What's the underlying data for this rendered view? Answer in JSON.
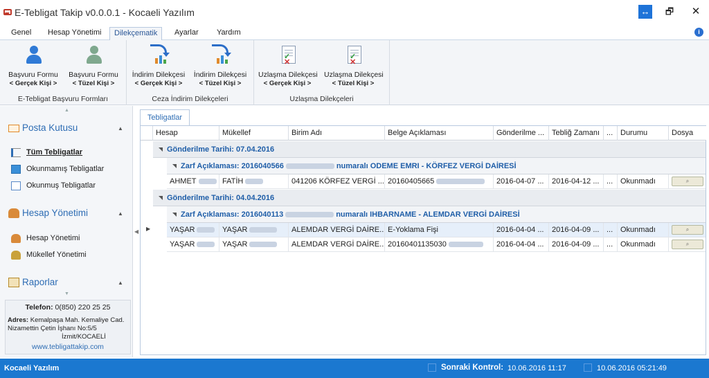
{
  "window": {
    "title": "E-Tebligat Takip v0.0.0.1 - Kocaeli Yazılım",
    "restore_glyph": "↔",
    "maximize_glyph": "🗗",
    "close_glyph": "✕"
  },
  "menu": {
    "tabs": [
      "Genel",
      "Hesap Yönetimi",
      "Dilekçematik",
      "Ayarlar",
      "Yardım"
    ],
    "active": "Dilekçematik",
    "info_glyph": "i"
  },
  "ribbon": {
    "groups": [
      {
        "label": "E-Tebligat Başvuru Formları",
        "buttons": [
          {
            "line1": "Başvuru Formu",
            "line2": "< Gerçek Kişi >",
            "icon": "person-blue-icon"
          },
          {
            "line1": "Başvuru Formu",
            "line2": "< Tüzel Kişi >",
            "icon": "person-green-icon"
          }
        ]
      },
      {
        "label": "Ceza İndirim Dilekçeleri",
        "buttons": [
          {
            "line1": "İndirim Dilekçesi",
            "line2": "< Gerçek Kişi >",
            "icon": "chart-refresh-icon"
          },
          {
            "line1": "İndirim Dilekçesi",
            "line2": "< Tüzel Kişi >",
            "icon": "chart-refresh-icon"
          }
        ]
      },
      {
        "label": "Uzlaşma Dilekçeleri",
        "buttons": [
          {
            "line1": "Uzlaşma Dilekçesi",
            "line2": "< Gerçek Kişi >",
            "icon": "checklist-icon"
          },
          {
            "line1": "Uzlaşma Dilekçesi",
            "line2": "< Tüzel Kişi >",
            "icon": "checklist-icon"
          }
        ]
      }
    ]
  },
  "sidebar": {
    "sections": [
      {
        "title": "Posta Kutusu",
        "icon": "envelope-icon",
        "items": [
          {
            "label": "Tüm Tebligatlar",
            "icon": "list-icon",
            "selected": true
          },
          {
            "label": "Okunmamış Tebligatlar",
            "icon": "unread-icon"
          },
          {
            "label": "Okunmuş Tebligatlar",
            "icon": "read-icon"
          }
        ]
      },
      {
        "title": "Hesap Yönetimi",
        "icon": "users-icon",
        "items": [
          {
            "label": "Hesap Yönetimi",
            "icon": "user-icon"
          },
          {
            "label": "Mükellef Yönetimi",
            "icon": "group-icon"
          }
        ]
      },
      {
        "title": "Raporlar",
        "icon": "clipboard-icon",
        "items": []
      }
    ],
    "contact": {
      "phone_label": "Telefon:",
      "phone": "0(850) 220 25 25",
      "address_label": "Adres:",
      "address_line1": "Kemalpaşa Mah. Kemaliye Cad.",
      "address_line2": "Nizamettin Çetin İşhanı No:5/5",
      "address_line3": "İzmit/KOCAELİ",
      "website": "www.tebligattakip.com"
    }
  },
  "grid": {
    "tab_label": "Tebligatlar",
    "columns": [
      "Hesap",
      "Mükellef",
      "Birim Adı",
      "Belge Açıklaması",
      "Gönderilme ...",
      "Tebliğ Zamanı",
      "...",
      "Durumu",
      "Dosya"
    ],
    "groups": [
      {
        "date_label": "Gönderilme Tarihi: 07.04.2016",
        "subgroups": [
          {
            "label_prefix": "Zarf Açıklaması: 2016040566",
            "label_suffix": "numaralı ODEME EMRI - KÖRFEZ VERGİ DAİRESİ",
            "rows": [
              {
                "hesap": "AHMET",
                "mukellef": "FATİH",
                "birim": "041206 KÖRFEZ VERGİ ...",
                "belge": "20160405665",
                "gonderilme": "2016-04-07 ...",
                "teblig": "2016-04-12 ...",
                "extra": "...",
                "durum": "Okunmadı"
              }
            ]
          }
        ]
      },
      {
        "date_label": "Gönderilme Tarihi: 04.04.2016",
        "subgroups": [
          {
            "label_prefix": "Zarf Açıklaması: 2016040113",
            "label_suffix": "numaralı IHBARNAME - ALEMDAR VERGİ DAİRESİ",
            "rows": [
              {
                "hesap": "YAŞAR",
                "mukellef": "YAŞAR",
                "birim": "ALEMDAR VERGİ DAİRE...",
                "belge": "E-Yoklama Fişi",
                "gonderilme": "2016-04-04 ...",
                "teblig": "2016-04-09 ...",
                "extra": "...",
                "durum": "Okunmadı"
              },
              {
                "hesap": "YAŞAR",
                "mukellef": "YAŞAR",
                "birim": "ALEMDAR VERGİ DAİRE...",
                "belge": "20160401135030",
                "gonderilme": "2016-04-04 ...",
                "teblig": "2016-04-09 ...",
                "extra": "...",
                "durum": "Okunmadı"
              }
            ]
          }
        ]
      }
    ]
  },
  "statusbar": {
    "company": "Kocaeli Yazılım",
    "next_check_label": "Sonraki Kontrol:",
    "next_check_value": "10.06.2016 11:17",
    "now_value": "10.06.2016 05:21:49"
  },
  "colors": {
    "accent": "#1b78d0",
    "link": "#2e6db4",
    "group_text": "#1f5ea8"
  }
}
